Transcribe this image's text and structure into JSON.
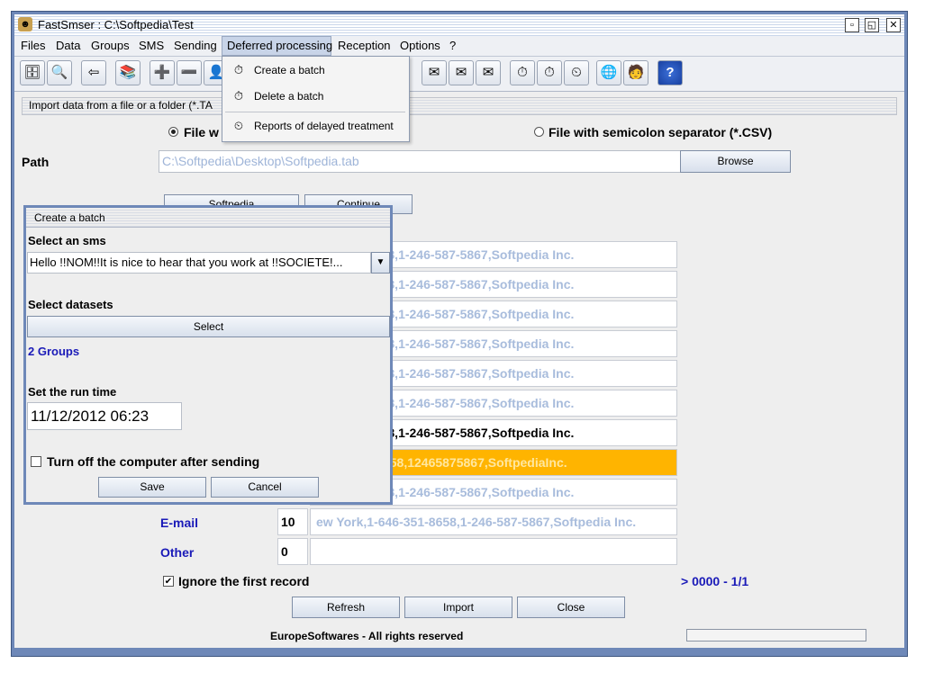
{
  "window": {
    "title": "FastSmser : C:\\Softpedia\\Test"
  },
  "menu": [
    "Files",
    "Data",
    "Groups",
    "SMS",
    "Sending",
    "Deferred processing",
    "Reception",
    "Options",
    "?"
  ],
  "deferred_menu": {
    "create": "Create a batch",
    "delete": "Delete a batch",
    "reports": "Reports of delayed treatment"
  },
  "import": {
    "header": "Import data from a file or a folder (*.TA",
    "radio_tab": "File w",
    "radio_csv": "File with semicolon separator (*.CSV)",
    "path_label": "Path",
    "path_value": "C:\\Softpedia\\Desktop\\Softpedia.tab",
    "browse": "Browse",
    "combo_left": "Softpedia",
    "combo_right": "Continue"
  },
  "rows": [
    "646-351-8658,1-246-587-5867,Softpedia Inc.",
    "646-351-8658,1-246-587-5867,Softpedia Inc.",
    "646-351-8658,1-246-587-5867,Softpedia Inc.",
    "646-351-8658,1-246-587-5867,Softpedia Inc.",
    "646-351-8658,1-246-587-5867,Softpedia Inc.",
    "646-351-8658,1-246-587-5867,Softpedia Inc.",
    "646-351-8658,1-246-587-5867,Softpedia Inc.",
    "k,16463518658,12465875867,SoftpediaInc.",
    "646-351-8658,1-246-587-5867,Softpedia Inc.",
    "ew York,1-646-351-8658,1-246-587-5867,Softpedia Inc.",
    ""
  ],
  "fields": {
    "email_label": "E-mail",
    "email_value": "10",
    "other_label": "Other",
    "other_value": "0"
  },
  "ignore_first": "Ignore the first record",
  "counter": "> 0000 - 1/1",
  "buttons": {
    "refresh": "Refresh",
    "import": "Import",
    "close": "Close"
  },
  "footer": "EuropeSoftwares - All rights reserved",
  "dialog": {
    "title": "Create a batch",
    "select_sms_label": "Select an sms",
    "sms_value": "Hello !!NOM!!It is nice to hear that you work at !!SOCIETE!...",
    "select_datasets_label": "Select datasets",
    "select_button": "Select",
    "groups": "2 Groups",
    "run_time_label": "Set the run time",
    "run_time_value": "11/12/2012 06:23",
    "turn_off": "Turn off the computer after sending",
    "save": "Save",
    "cancel": "Cancel"
  },
  "colors": {
    "accent": "#6e88b8",
    "highlight": "#ffb400",
    "link_blue": "#1a1ab8"
  }
}
